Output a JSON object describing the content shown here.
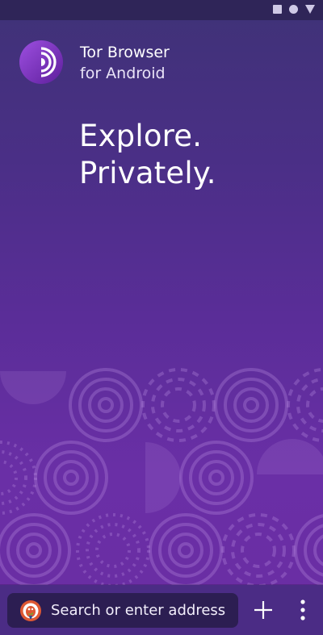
{
  "header": {
    "app_name": "Tor Browser",
    "app_subtitle": "for Android"
  },
  "hero": {
    "line1": "Explore.",
    "line2": "Privately."
  },
  "toolbar": {
    "search_text": "Search or enter address"
  },
  "icons": {
    "logo": "tor-onion-icon",
    "search_engine": "duckduckgo-icon",
    "new_tab": "plus-icon",
    "menu": "three-dot-menu-icon",
    "status": [
      "square-icon",
      "circle-icon",
      "triangle-icon"
    ]
  },
  "colors": {
    "background_top": "#3f3277",
    "background_bottom": "#6a2da3",
    "toolbar": "#4b2c85",
    "url_bar": "#2c1e52",
    "logo_purple": "#7e3bc2"
  }
}
